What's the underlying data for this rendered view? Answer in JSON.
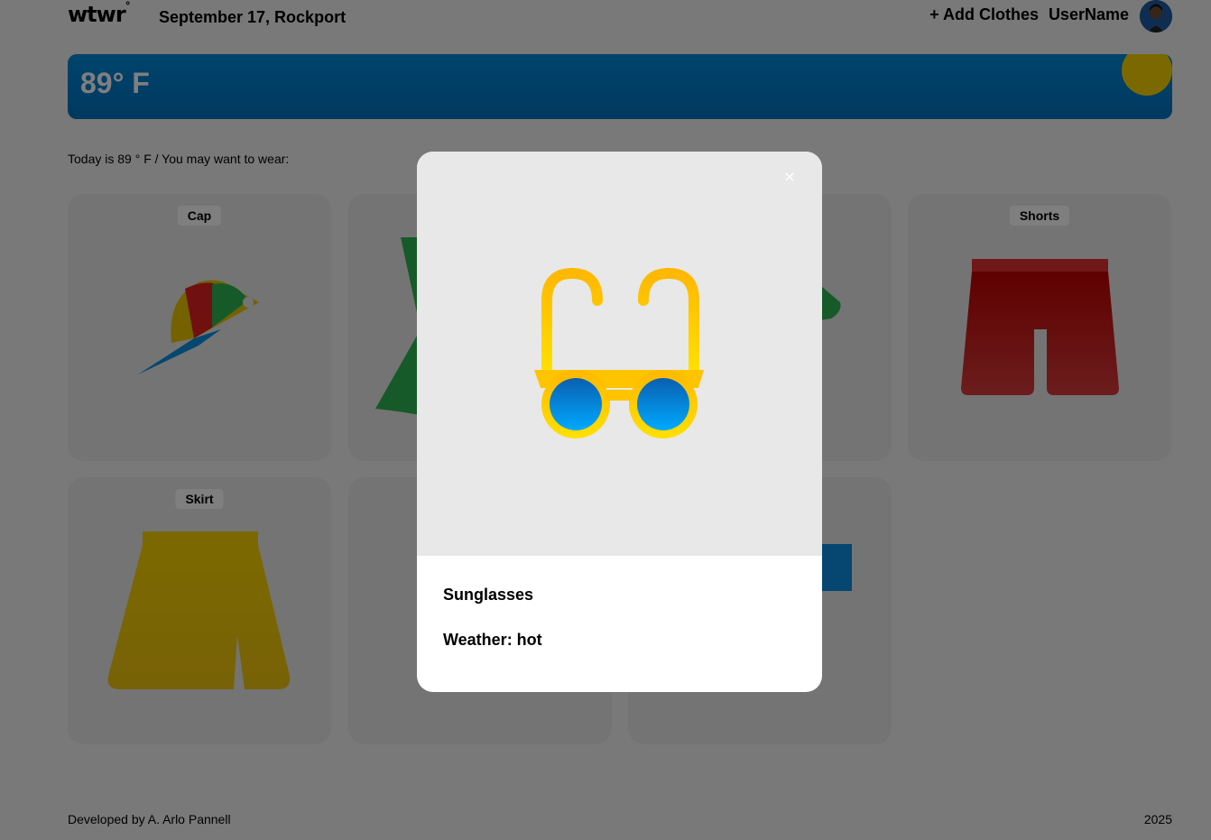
{
  "header": {
    "logo": "wtwr",
    "logo_mark": "°",
    "date_location": "September 17, Rockport",
    "add_clothes_label": "+ Add Clothes",
    "username": "UserName"
  },
  "weather": {
    "temperature": "89° F",
    "accent_color": "#0189d8",
    "sun_color": "#f7d200"
  },
  "main": {
    "today_text": "Today is 89 ° F / You may want to wear:"
  },
  "cards": [
    {
      "label": "Cap",
      "icon": "cap-icon"
    },
    {
      "label": "",
      "icon": "green-garment-icon"
    },
    {
      "label": "",
      "icon": "green-garment-icon"
    },
    {
      "label": "Shorts",
      "icon": "shorts-icon"
    },
    {
      "label": "Skirt",
      "icon": "skirt-icon"
    },
    {
      "label": "",
      "icon": ""
    },
    {
      "label": "",
      "icon": "blue-garment-icon"
    }
  ],
  "modal": {
    "close_label": "×",
    "item_name": "Sunglasses",
    "weather_label": "Weather: hot",
    "icon": "sunglasses-icon"
  },
  "footer": {
    "developer": "Developed by A. Arlo Pannell",
    "year": "2025"
  }
}
